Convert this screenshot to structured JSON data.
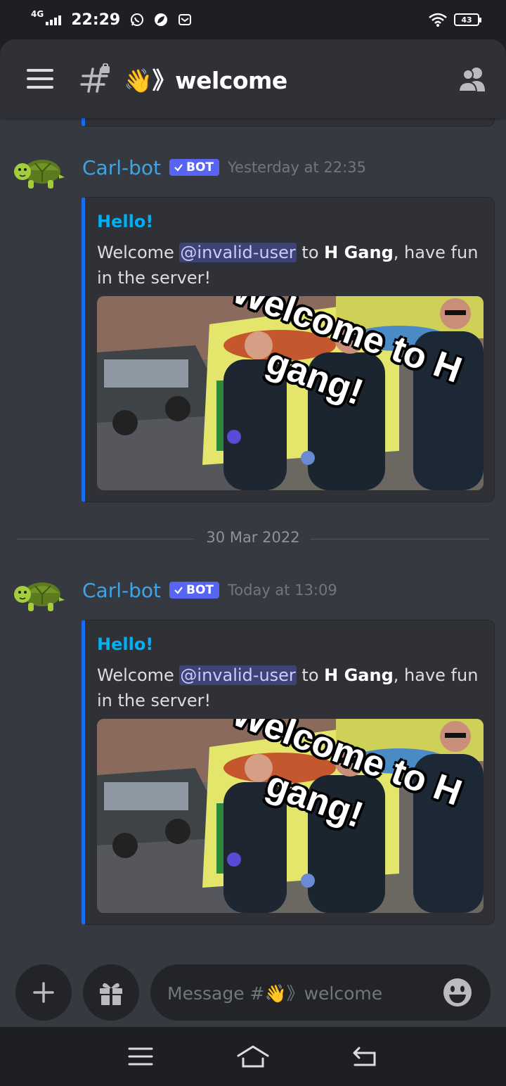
{
  "status_bar": {
    "network": "4G",
    "time": "22:29",
    "battery": "43"
  },
  "header": {
    "channel_name": "👋》welcome"
  },
  "messages": [
    {
      "author": "Carl-bot",
      "bot_tag": "BOT",
      "timestamp": "Yesterday at 22:35",
      "embed": {
        "title": "Hello!",
        "desc_prefix": "Welcome ",
        "mention": "@invalid-user",
        "desc_mid": " to ",
        "server": "H Gang",
        "desc_suffix": ", have fun in the server!",
        "gif_line1": "Welcome to H",
        "gif_line2": "gang!"
      }
    },
    {
      "author": "Carl-bot",
      "bot_tag": "BOT",
      "timestamp": "Today at 13:09",
      "embed": {
        "title": "Hello!",
        "desc_prefix": "Welcome ",
        "mention": "@invalid-user",
        "desc_mid": " to ",
        "server": "H Gang",
        "desc_suffix": ", have fun in the server!",
        "gif_line1": "Welcome to H",
        "gif_line2": "gang!"
      }
    }
  ],
  "date_divider": "30 Mar 2022",
  "composer": {
    "placeholder": "Message #👋》welcome"
  },
  "colors": {
    "accent": "#5865f2",
    "link": "#00aff4",
    "author": "#3da4e6",
    "embed_bar": "#1a6cf0"
  },
  "icons": {
    "menu": "hamburger-icon",
    "channel": "locked-hash-icon",
    "members": "members-icon",
    "add": "plus-icon",
    "gift": "gift-icon",
    "emoji": "emoji-icon"
  }
}
